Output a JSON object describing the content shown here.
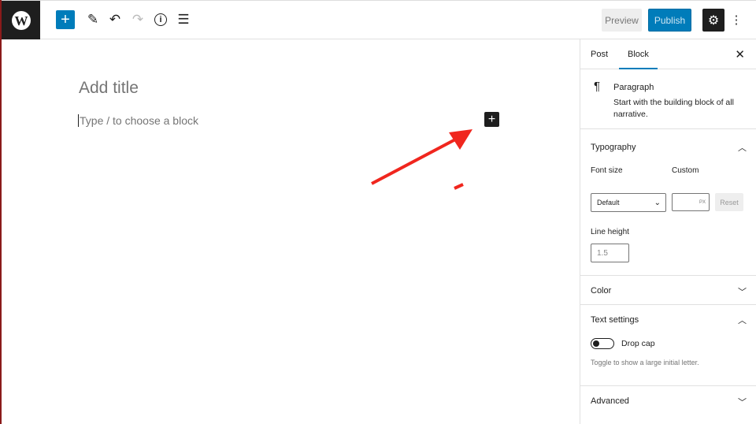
{
  "toolbar": {
    "preview": "Preview",
    "publish": "Publish",
    "icons": [
      "wordpress-logo",
      "plus",
      "pencil",
      "undo",
      "redo",
      "info",
      "list-view",
      "settings",
      "more-vertical"
    ]
  },
  "editor": {
    "title_placeholder": "Add title",
    "block_placeholder": "Type / to choose a block"
  },
  "sidebar": {
    "tabs": [
      "Post",
      "Block"
    ],
    "block": {
      "name": "Paragraph",
      "description": "Start with the building block of all narrative."
    },
    "typography": {
      "title": "Typography",
      "font_size_label": "Font size",
      "font_size_value": "Default",
      "custom_label": "Custom",
      "custom_unit": "PX",
      "reset": "Reset",
      "line_height_label": "Line height",
      "line_height_placeholder": "1.5"
    },
    "color": {
      "title": "Color"
    },
    "text_settings": {
      "title": "Text settings",
      "drop_cap": "Drop cap",
      "drop_cap_enabled": false,
      "help": "Toggle to show a large initial letter."
    },
    "advanced": {
      "title": "Advanced"
    }
  },
  "colors": {
    "accent": "#007cba",
    "annotation": "#f0261e"
  }
}
